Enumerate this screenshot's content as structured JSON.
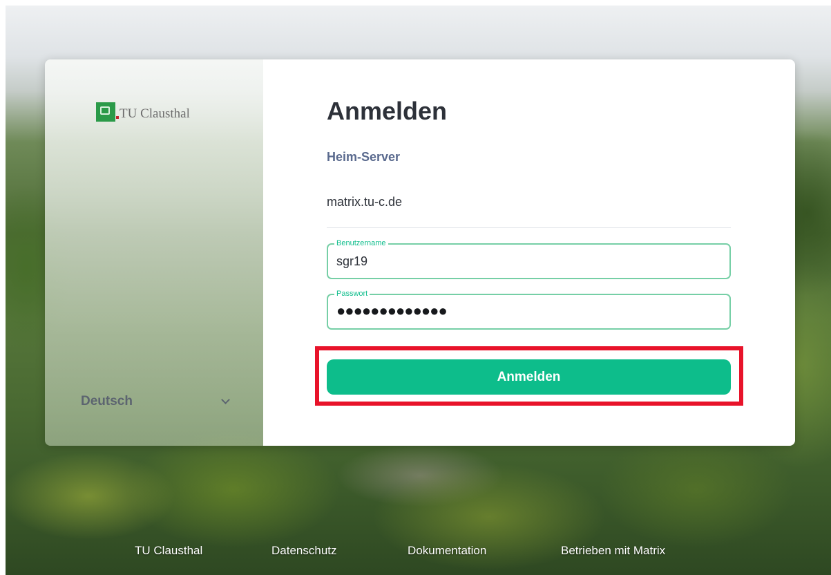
{
  "branding": {
    "org_name": "TU Clausthal",
    "logo_icon": "tu-clausthal-logo-icon"
  },
  "language": {
    "selected": "Deutsch",
    "icon": "chevron-down-icon"
  },
  "login": {
    "title": "Anmelden",
    "homeserver_label": "Heim-Server",
    "homeserver_value": "matrix.tu-c.de",
    "username_label": "Benutzername",
    "username_value": "sgr19",
    "password_label": "Passwort",
    "password_mask": "●●●●●●●●●●●●●",
    "submit_label": "Anmelden"
  },
  "footer": {
    "links": [
      "TU Clausthal",
      "Datenschutz",
      "Dokumentation",
      "Betrieben mit Matrix"
    ]
  },
  "colors": {
    "accent": "#0dbd8b",
    "field_border": "#76cfa6",
    "highlight": "#e8132a",
    "label_blue": "#5a6a8e"
  }
}
